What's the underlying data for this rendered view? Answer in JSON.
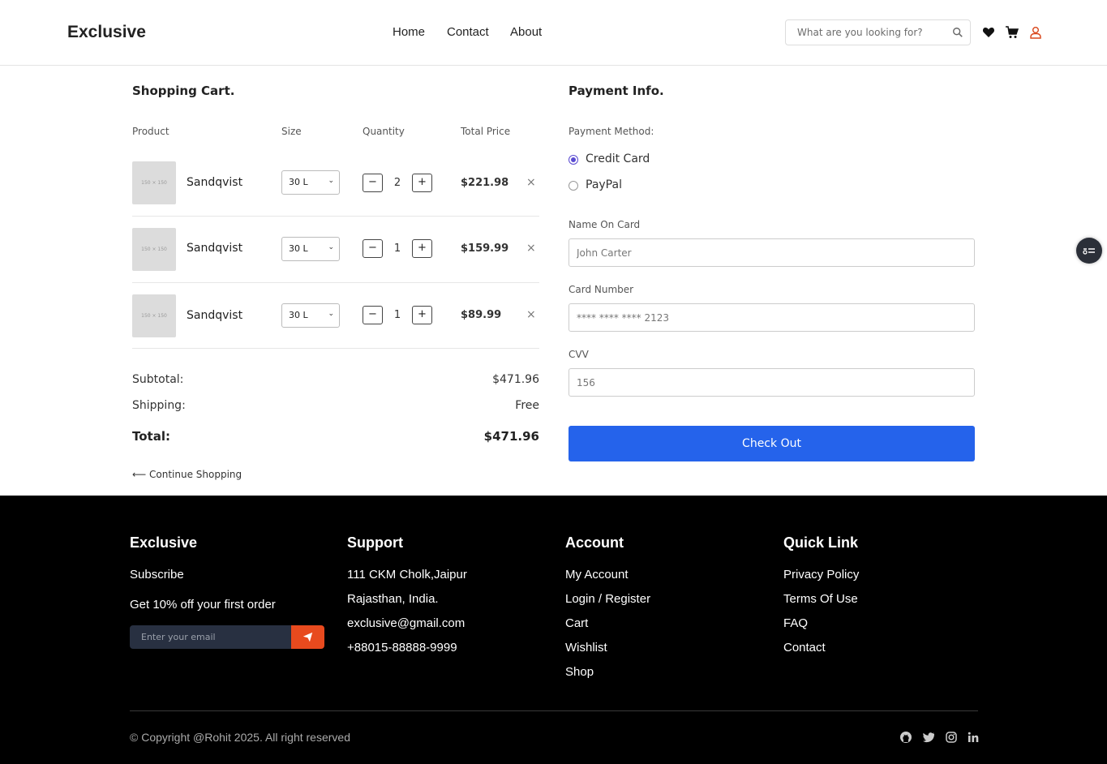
{
  "header": {
    "brand": "Exclusive",
    "nav": [
      "Home",
      "Contact",
      "About"
    ],
    "search_placeholder": "What are you looking for?"
  },
  "cart": {
    "title": "Shopping Cart.",
    "columns": [
      "Product",
      "Size",
      "Quantity",
      "Total Price"
    ],
    "items": [
      {
        "thumb": "150 × 150",
        "name": "Sandqvist",
        "size": "30 L",
        "qty": "2",
        "price": "$221.98"
      },
      {
        "thumb": "150 × 150",
        "name": "Sandqvist",
        "size": "30 L",
        "qty": "1",
        "price": "$159.99"
      },
      {
        "thumb": "150 × 150",
        "name": "Sandqvist",
        "size": "30 L",
        "qty": "1",
        "price": "$89.99"
      }
    ],
    "minus": "−",
    "plus": "+",
    "remove": "×",
    "subtotal_label": "Subtotal:",
    "subtotal": "$471.96",
    "shipping_label": "Shipping:",
    "shipping": "Free",
    "total_label": "Total:",
    "total": "$471.96",
    "continue": "⟵ Continue Shopping"
  },
  "payment": {
    "title": "Payment Info.",
    "method_label": "Payment Method:",
    "methods": [
      {
        "label": "Credit Card",
        "selected": true
      },
      {
        "label": "PayPal",
        "selected": false
      }
    ],
    "name_label": "Name On Card",
    "name_placeholder": "John Carter",
    "card_label": "Card Number",
    "card_placeholder": "**** **** **** 2123",
    "cvv_label": "CVV",
    "cvv_placeholder": "156",
    "checkout": "Check Out",
    "accent_color": "#2563eb"
  },
  "footer": {
    "col1": {
      "title": "Exclusive",
      "subscribe": "Subscribe",
      "offer": "Get 10% off your first order",
      "email_placeholder": "Enter your email"
    },
    "col2": {
      "title": "Support",
      "lines": [
        "111 CKM Cholk,Jaipur",
        "Rajasthan, India.",
        "exclusive@gmail.com",
        "+88015-88888-9999"
      ]
    },
    "col3": {
      "title": "Account",
      "links": [
        "My Account",
        "Login / Register",
        "Cart",
        "Wishlist",
        "Shop"
      ]
    },
    "col4": {
      "title": "Quick Link",
      "links": [
        "Privacy Policy",
        "Terms Of Use",
        "FAQ",
        "Contact"
      ]
    },
    "copyright": "© Copyright @Rohit 2025. All right reserved",
    "social": [
      "github-icon",
      "twitter-icon",
      "instagram-icon",
      "linkedin-icon"
    ],
    "send_color": "#e84a1e"
  }
}
